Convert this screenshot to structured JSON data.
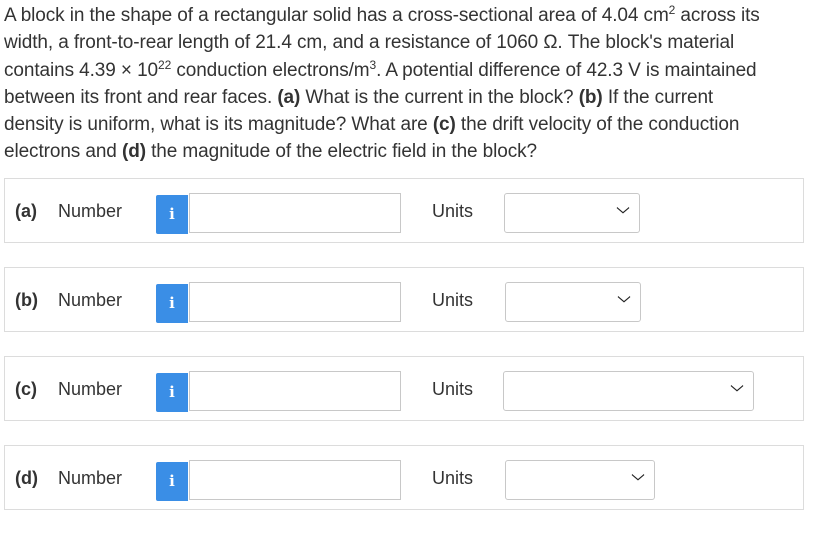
{
  "question": {
    "l1_a": "A block in the shape of a rectangular solid has a cross-sectional area of 4.04 cm",
    "l1_sup": "2",
    "l1_b": " across its",
    "l2": "width, a front-to-rear length of 21.4 cm, and a resistance of 1060 Ω. The block's material",
    "l3_a": "contains 4.39 × 10",
    "l3_sup1": "22",
    "l3_b": " conduction electrons/m",
    "l3_sup2": "3",
    "l3_c": ". A potential difference of 42.3 V is maintained",
    "l4_a": "between its front and rear faces. ",
    "l4_pa": "(a)",
    "l4_b": " What is the current in the block? ",
    "l4_pb": "(b)",
    "l4_c": " If the current",
    "l5_a": "density is uniform, what is its magnitude? What are ",
    "l5_pc": "(c)",
    "l5_b": " the drift velocity of the conduction",
    "l6_a": "electrons and ",
    "l6_pd": "(d)",
    "l6_b": " the magnitude of the electric field in the block?"
  },
  "rows": [
    {
      "part": "(a)",
      "number_label": "Number",
      "info_icon": "i",
      "value": "",
      "units_label": "Units",
      "units_value": ""
    },
    {
      "part": "(b)",
      "number_label": "Number",
      "info_icon": "i",
      "value": "",
      "units_label": "Units",
      "units_value": ""
    },
    {
      "part": "(c)",
      "number_label": "Number",
      "info_icon": "i",
      "value": "",
      "units_label": "Units",
      "units_value": ""
    },
    {
      "part": "(d)",
      "number_label": "Number",
      "info_icon": "i",
      "value": "",
      "units_label": "Units",
      "units_value": ""
    }
  ],
  "chevron_icon": "chevron-down-icon",
  "colors": {
    "info_button": "#3a8ee6",
    "text": "#333333",
    "border": "#dcdcdc"
  }
}
